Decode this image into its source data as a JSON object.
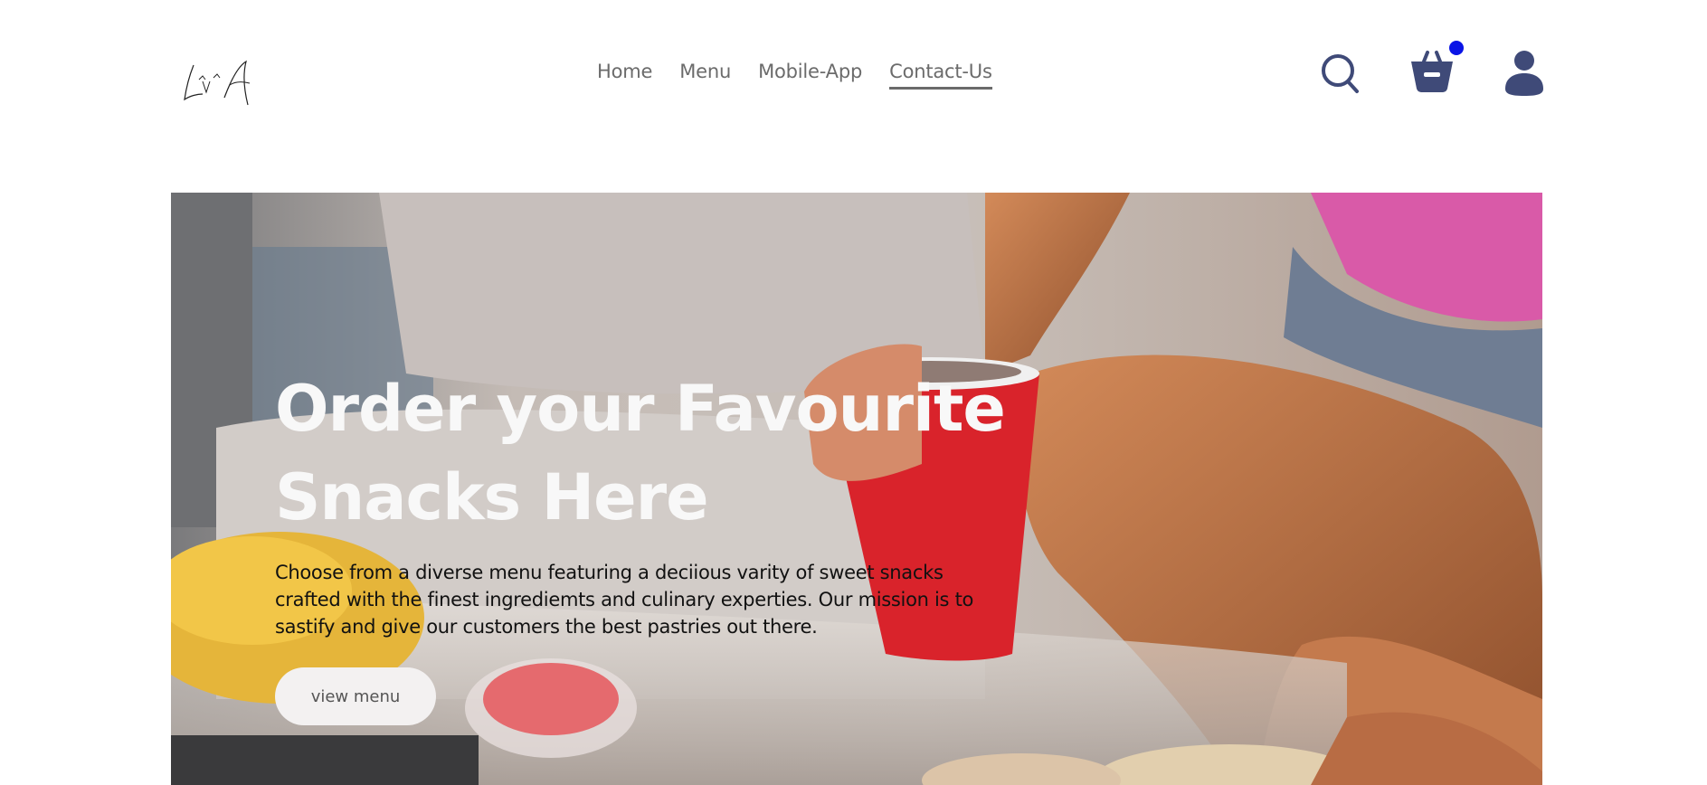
{
  "header": {
    "logo_text": "L^v^A",
    "nav": [
      {
        "label": "Home",
        "active": false
      },
      {
        "label": "Menu",
        "active": false
      },
      {
        "label": "Mobile-App",
        "active": false
      },
      {
        "label": "Contact-Us",
        "active": true
      }
    ],
    "icons": {
      "search": "search-icon",
      "cart": "basket-icon",
      "user": "user-icon"
    },
    "cart_indicator_color": "#0a14e6",
    "icon_color": "#3f4a78"
  },
  "hero": {
    "title_line1": "Order your Favourite",
    "title_line2": "Snacks Here",
    "description": "Choose from a diverse menu featuring a deciious varity of sweet snacks crafted with the finest ingrediemts and culinary experties. Our mission is to sastify and give our customers the best pastries out there.",
    "button_label": "view menu"
  }
}
